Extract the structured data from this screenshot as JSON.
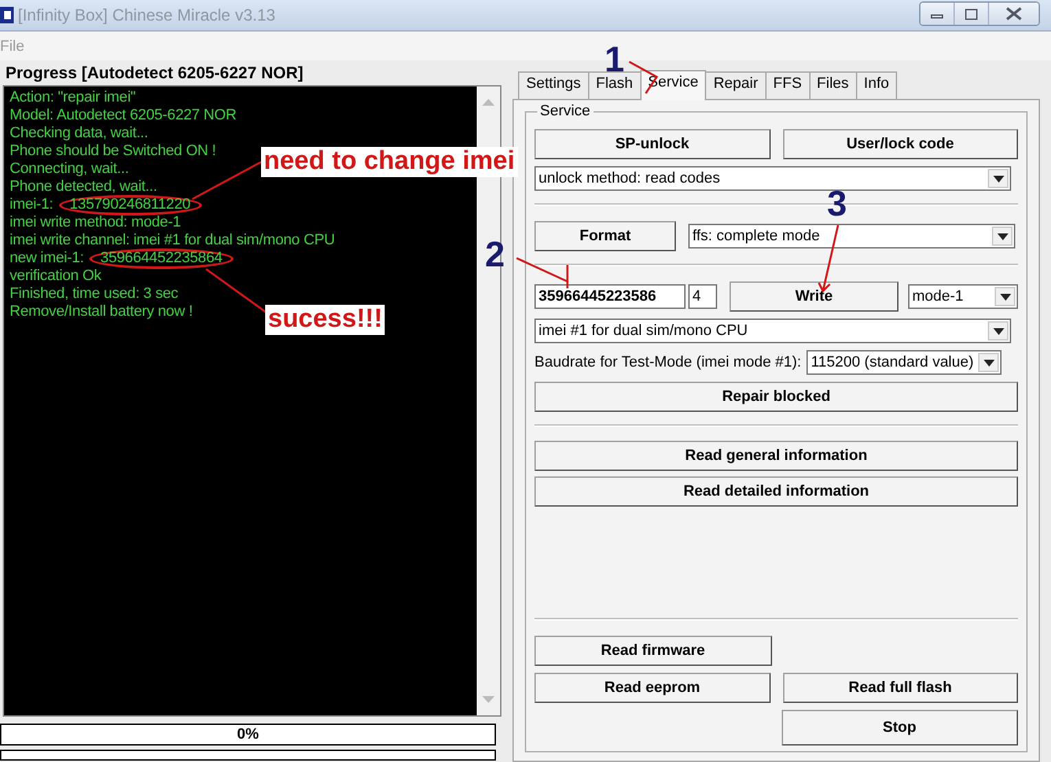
{
  "window": {
    "title": "[Infinity Box] Chinese Miracle v3.13"
  },
  "menu": [
    "File"
  ],
  "progress": {
    "title": "Progress [Autodetect 6205-6227 NOR]",
    "log": [
      "Action: \"repair imei\"",
      "Model: Autodetect 6205-6227 NOR",
      "Checking data, wait...",
      "Phone should be Switched ON !",
      "Connecting, wait...",
      "Phone detected, wait...",
      {
        "label": "imei-1:",
        "value": "135790246811220",
        "circled": true
      },
      "imei write method: mode-1",
      "imei write channel: imei #1 for dual sim/mono CPU",
      {
        "label": "new imei-1:",
        "value": "359664452235864",
        "circled": true
      },
      "verification Ok",
      "Finished, time used: 3 sec",
      "Remove/Install battery now !"
    ],
    "bar": {
      "label": "0%",
      "level": 0
    },
    "bar_2": {
      "level": 0
    }
  },
  "tabs": [
    {
      "label": "Settings",
      "selected": false
    },
    {
      "label": "Flash",
      "selected": false
    },
    {
      "label": "Service",
      "selected": true
    },
    {
      "label": "Repair",
      "selected": false
    },
    {
      "label": "FFS",
      "selected": false
    },
    {
      "label": "Files",
      "selected": false
    },
    {
      "label": "Info",
      "selected": false
    }
  ],
  "service": {
    "title": "Service",
    "unlock_buttons": [
      "SP-unlock",
      "User/lock code"
    ],
    "unlock_method": "unlock method: read codes",
    "format_button": "Format",
    "format_mode": "ffs: complete mode",
    "imei_value": "35966445223586",
    "imei_check": "4",
    "write_button": "Write",
    "write_mode": "mode-1",
    "channel": "imei #1 for dual sim/mono CPU",
    "baud_label": "Baudrate for Test-Mode (imei mode #1):",
    "baud_value": "115200 (standard value)",
    "repair_button": "Repair blocked",
    "info_buttons": [
      "Read general information",
      "Read detailed information"
    ],
    "read_firmware": "Read firmware",
    "read_eeprom": "Read eeprom",
    "read_full_flash": "Read full flash",
    "stop": "Stop"
  },
  "annotations": [
    {
      "kind": "callout",
      "text": "need to change imei"
    },
    {
      "kind": "callout",
      "text": "sucess!!!"
    },
    {
      "kind": "step",
      "text": "1"
    },
    {
      "kind": "step",
      "text": "2"
    },
    {
      "kind": "step",
      "text": "3"
    }
  ]
}
